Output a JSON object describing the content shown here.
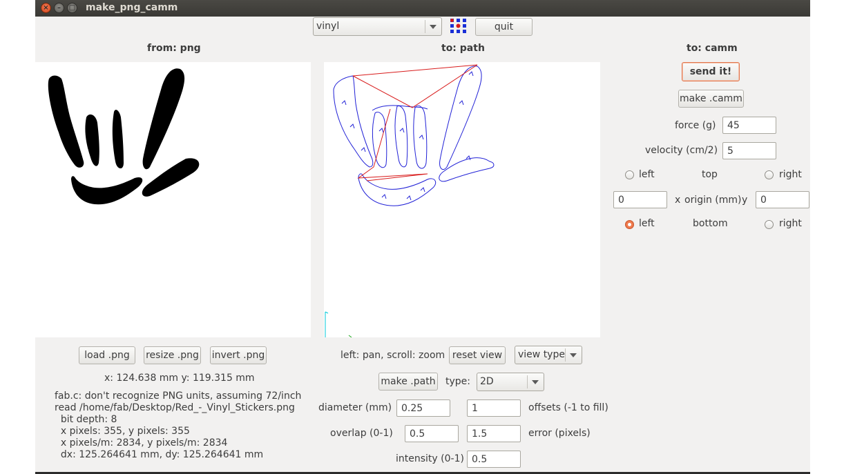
{
  "window": {
    "title": "make_png_camm"
  },
  "toolbar": {
    "machine_selected": "vinyl",
    "quit_label": "quit",
    "logo_icon": "fab-grid-icon"
  },
  "from_panel": {
    "header": "from: png",
    "load_label": "load .png",
    "resize_label": "resize .png",
    "invert_label": "invert .png",
    "coords": "x: 124.638 mm  y: 119.315 mm",
    "info_lines": [
      "fab.c: don't recognize PNG units, assuming 72/inch",
      "read /home/fab/Desktop/Red_-_Vinyl_Stickers.png",
      "  bit depth: 8",
      "  x pixels: 355, y pixels: 355",
      "  x pixels/m: 2834, y pixels/m: 2834",
      "  dx: 125.264641 mm, dy: 125.264641 mm"
    ]
  },
  "path_panel": {
    "header": "to: path",
    "hint": "left: pan, scroll: zoom",
    "reset_view_label": "reset view",
    "view_type_label": "view type",
    "make_path_label": "make .path",
    "type_label": "type:",
    "type_value": "2D",
    "diameter_label": "diameter (mm)",
    "diameter_value": "0.25",
    "offsets_value": "1",
    "offsets_label": "offsets (-1 to fill)",
    "overlap_label": "overlap (0-1)",
    "overlap_value": "0.5",
    "error_value": "1.5",
    "error_label": "error (pixels)",
    "intensity_label": "intensity (0-1)",
    "intensity_value": "0.5",
    "colors": {
      "path": "#1f1fd6",
      "jump": "#d81a1a"
    }
  },
  "camm_panel": {
    "header": "to: camm",
    "send_label": "send it!",
    "make_camm_label": "make .camm",
    "force_label": "force (g)",
    "force_value": "45",
    "velocity_label": "velocity (cm/2)",
    "velocity_value": "5",
    "top_row": {
      "left": "left",
      "center": "top",
      "right": "right"
    },
    "origin_x_value": "0",
    "origin_x_label": "x",
    "origin_label": "origin (mm)",
    "origin_y_label": "y",
    "origin_y_value": "0",
    "bottom_row": {
      "left": "left",
      "center": "bottom",
      "right": "right"
    },
    "accent": "#ef7a4d"
  }
}
